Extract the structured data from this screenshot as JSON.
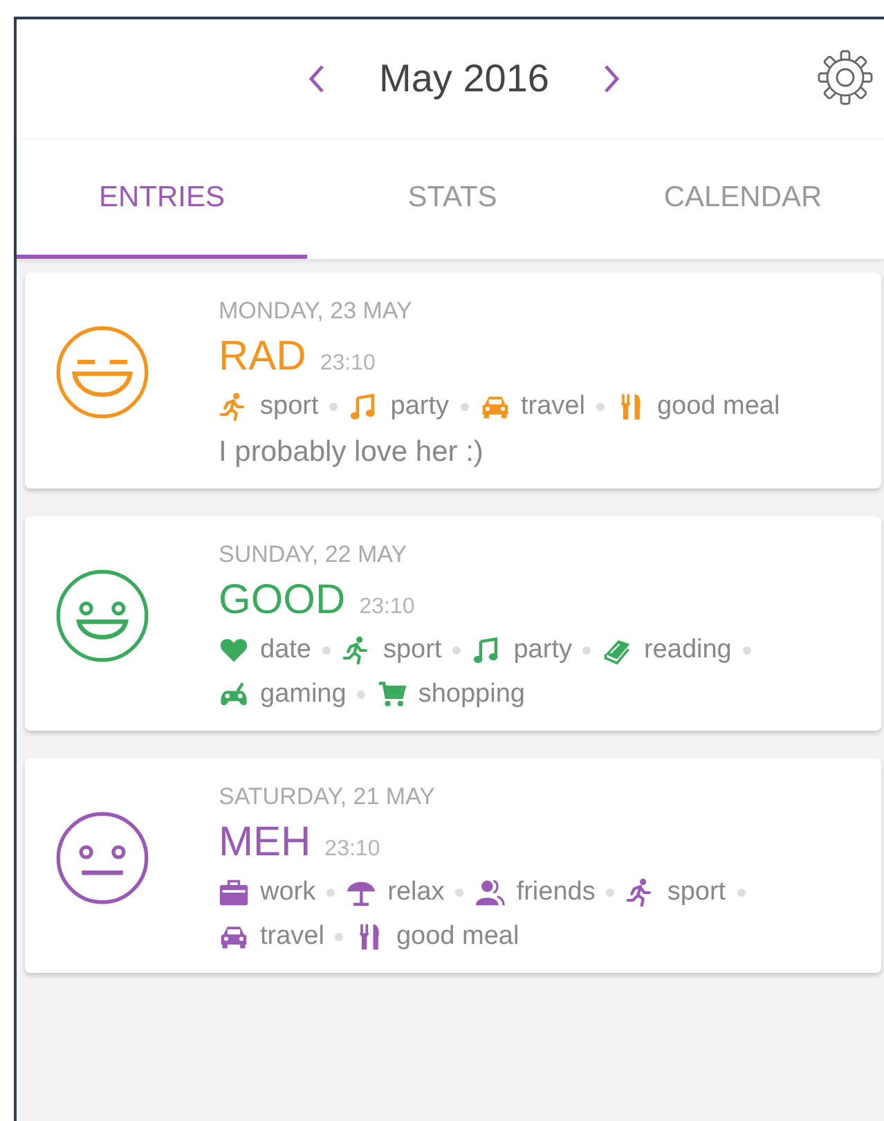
{
  "header": {
    "month": "May 2016"
  },
  "tabs": [
    {
      "label": "ENTRIES",
      "selected": true
    },
    {
      "label": "STATS",
      "selected": false
    },
    {
      "label": "CALENDAR",
      "selected": false
    }
  ],
  "entries": [
    {
      "date": "MONDAY, 23 MAY",
      "mood": "RAD",
      "kind": "rad",
      "color": "#f7941d",
      "time": "23:10",
      "activities": [
        {
          "kind": "run",
          "label": "sport"
        },
        {
          "kind": "music",
          "label": "party"
        },
        {
          "kind": "car",
          "label": "travel"
        },
        {
          "kind": "meal",
          "label": "good meal"
        }
      ],
      "note": "I probably love her :)"
    },
    {
      "date": "SUNDAY, 22 MAY",
      "mood": "GOOD",
      "kind": "good",
      "color": "#3aaa5c",
      "time": "23:10",
      "activities": [
        {
          "kind": "heart",
          "label": "date"
        },
        {
          "kind": "run",
          "label": "sport"
        },
        {
          "kind": "music",
          "label": "party"
        },
        {
          "kind": "book",
          "label": "reading"
        },
        {
          "kind": "gamepad",
          "label": "gaming"
        },
        {
          "kind": "cart",
          "label": "shopping"
        }
      ]
    },
    {
      "date": "SATURDAY, 21 MAY",
      "mood": "MEH",
      "kind": "meh",
      "color": "#9b59b6",
      "time": "23:10",
      "activities": [
        {
          "kind": "briefcase",
          "label": "work"
        },
        {
          "kind": "umbrella",
          "label": "relax"
        },
        {
          "kind": "people",
          "label": "friends"
        },
        {
          "kind": "run",
          "label": "sport"
        },
        {
          "kind": "car",
          "label": "travel"
        },
        {
          "kind": "meal",
          "label": "good meal"
        }
      ]
    }
  ]
}
